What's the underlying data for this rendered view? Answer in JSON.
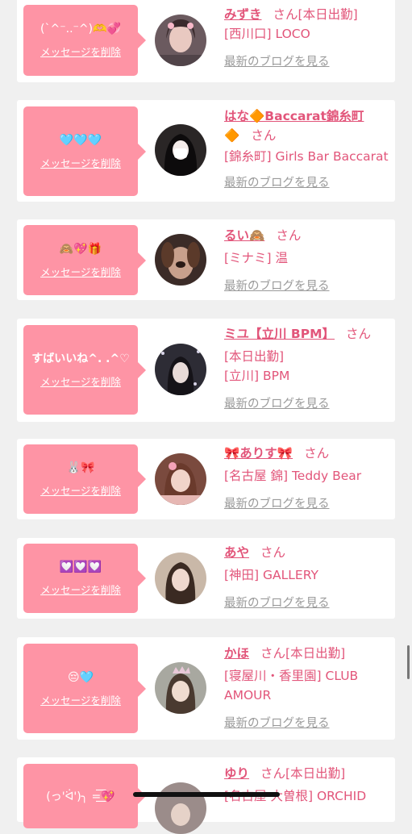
{
  "cards": [
    {
      "message": "(`^⁻..⁻^)🫶💞",
      "delete_label": "メッセージを削除",
      "name": "みずき",
      "san": "さん",
      "status": "[本日出勤]",
      "lines": [
        "[西川口] LOCO"
      ],
      "blog_label": "最新のブログを見る"
    },
    {
      "message": "🩵🩵🩵",
      "delete_label": "メッセージを削除",
      "name": "はな🔶Baccarat錦糸町",
      "name_cont": "🔶",
      "san": "さん",
      "status": "",
      "lines": [
        "[錦糸町] Girls Bar Baccarat"
      ],
      "blog_label": "最新のブログを見る"
    },
    {
      "message": "🙈💖🎁",
      "delete_label": "メッセージを削除",
      "name": "るい🙈",
      "san": "さん",
      "status": "",
      "lines": [
        "[ミナミ] 温"
      ],
      "blog_label": "最新のブログを見る"
    },
    {
      "message": "すばいいね^. .^♡",
      "delete_label": "メッセージを削除",
      "name": "ミユ【立川 BPM】",
      "san": "さん",
      "status": "",
      "lines": [
        "[本日出勤]",
        "[立川] BPM"
      ],
      "blog_label": "最新のブログを見る"
    },
    {
      "message": "🐰🎀",
      "delete_label": "メッセージを削除",
      "name": "🎀ありす🎀",
      "san": "さん",
      "status": "",
      "lines": [
        "[名古屋 錦] Teddy Bear"
      ],
      "blog_label": "最新のブログを見る"
    },
    {
      "message": "💟💟💟",
      "delete_label": "メッセージを削除",
      "name": "あや",
      "san": "さん",
      "status": "",
      "lines": [
        "[神田] GALLERY"
      ],
      "blog_label": "最新のブログを見る"
    },
    {
      "message": "😔🩵",
      "delete_label": "メッセージを削除",
      "name": "かほ",
      "san": "さん",
      "status": "[本日出勤]",
      "lines": [
        "[寝屋川・香里園] CLUB",
        "AMOUR"
      ],
      "blog_label": "最新のブログを見る"
    },
    {
      "message": "(っ'ᐛ')╮ =͟͟͞͞💖",
      "delete_label": "",
      "name": "ゆり",
      "san": "さん",
      "status": "[本日出勤]",
      "lines": [
        "[名古屋 大曽根] ORCHID"
      ],
      "blog_label": ""
    }
  ],
  "colors": {
    "bubble": "#fe94a5",
    "link": "#e2557a",
    "muted": "#9a9a9a",
    "background": "#f0f0f0"
  }
}
